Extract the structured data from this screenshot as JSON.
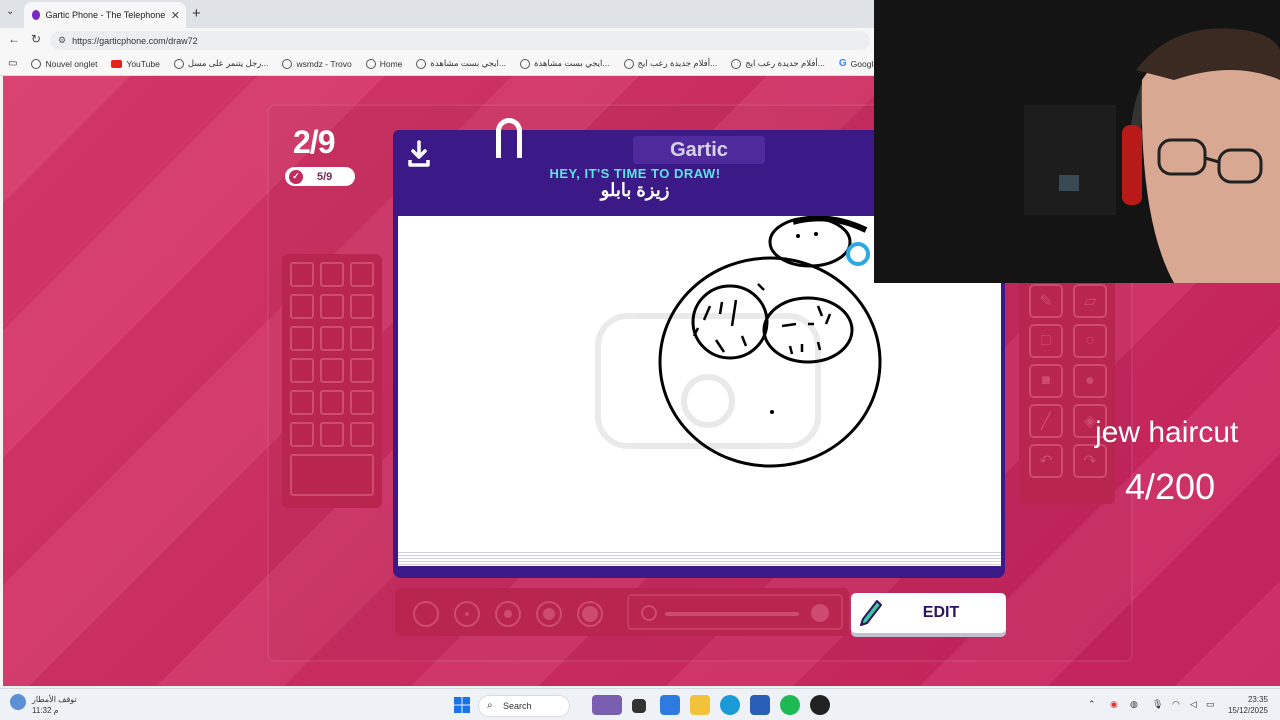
{
  "browser": {
    "tab_title": "Gartic Phone - The Telephone Gam",
    "tab_close": "✕",
    "new_tab": "+",
    "url": "https://garticphone.com/draw72",
    "bookmarks": [
      {
        "label": "Nouvel onglet",
        "icon": "globe-icon"
      },
      {
        "label": "YouTube",
        "icon": "youtube-icon"
      },
      {
        "label": "رجل يتنمر على مسل...",
        "icon": "globe-icon"
      },
      {
        "label": "wsmdz - Trovo",
        "icon": "globe-icon"
      },
      {
        "label": "Home",
        "icon": "globe-icon"
      },
      {
        "label": "ايجي بست مشاهدة...",
        "icon": "globe-icon"
      },
      {
        "label": "ايجي بست مشاهدة...",
        "icon": "globe-icon"
      },
      {
        "label": "أفلام جديدة رعب ايج...",
        "icon": "globe-icon"
      },
      {
        "label": "أفلام جديدة رعب ايج...",
        "icon": "globe-icon"
      },
      {
        "label": "Google",
        "icon": "google-icon"
      }
    ]
  },
  "game": {
    "round": "2/9",
    "players_done": "5/9",
    "logo": "Gartic",
    "prompt_title": "HEY, IT'S TIME TO DRAW!",
    "prompt_subject": "زيزة بابلو",
    "edit_label": "EDIT",
    "colors": {
      "accent_purple": "#3b1a87",
      "background": "#d7396a",
      "cyan": "#5ee3e3"
    }
  },
  "overlay": {
    "text": "jew haircut",
    "counter": "4/200"
  },
  "taskbar": {
    "weather_line1": "توقف الأمطار",
    "weather_line2": "11:32 م",
    "search": "Search",
    "time": "23:35",
    "date": "15/12/2025"
  }
}
